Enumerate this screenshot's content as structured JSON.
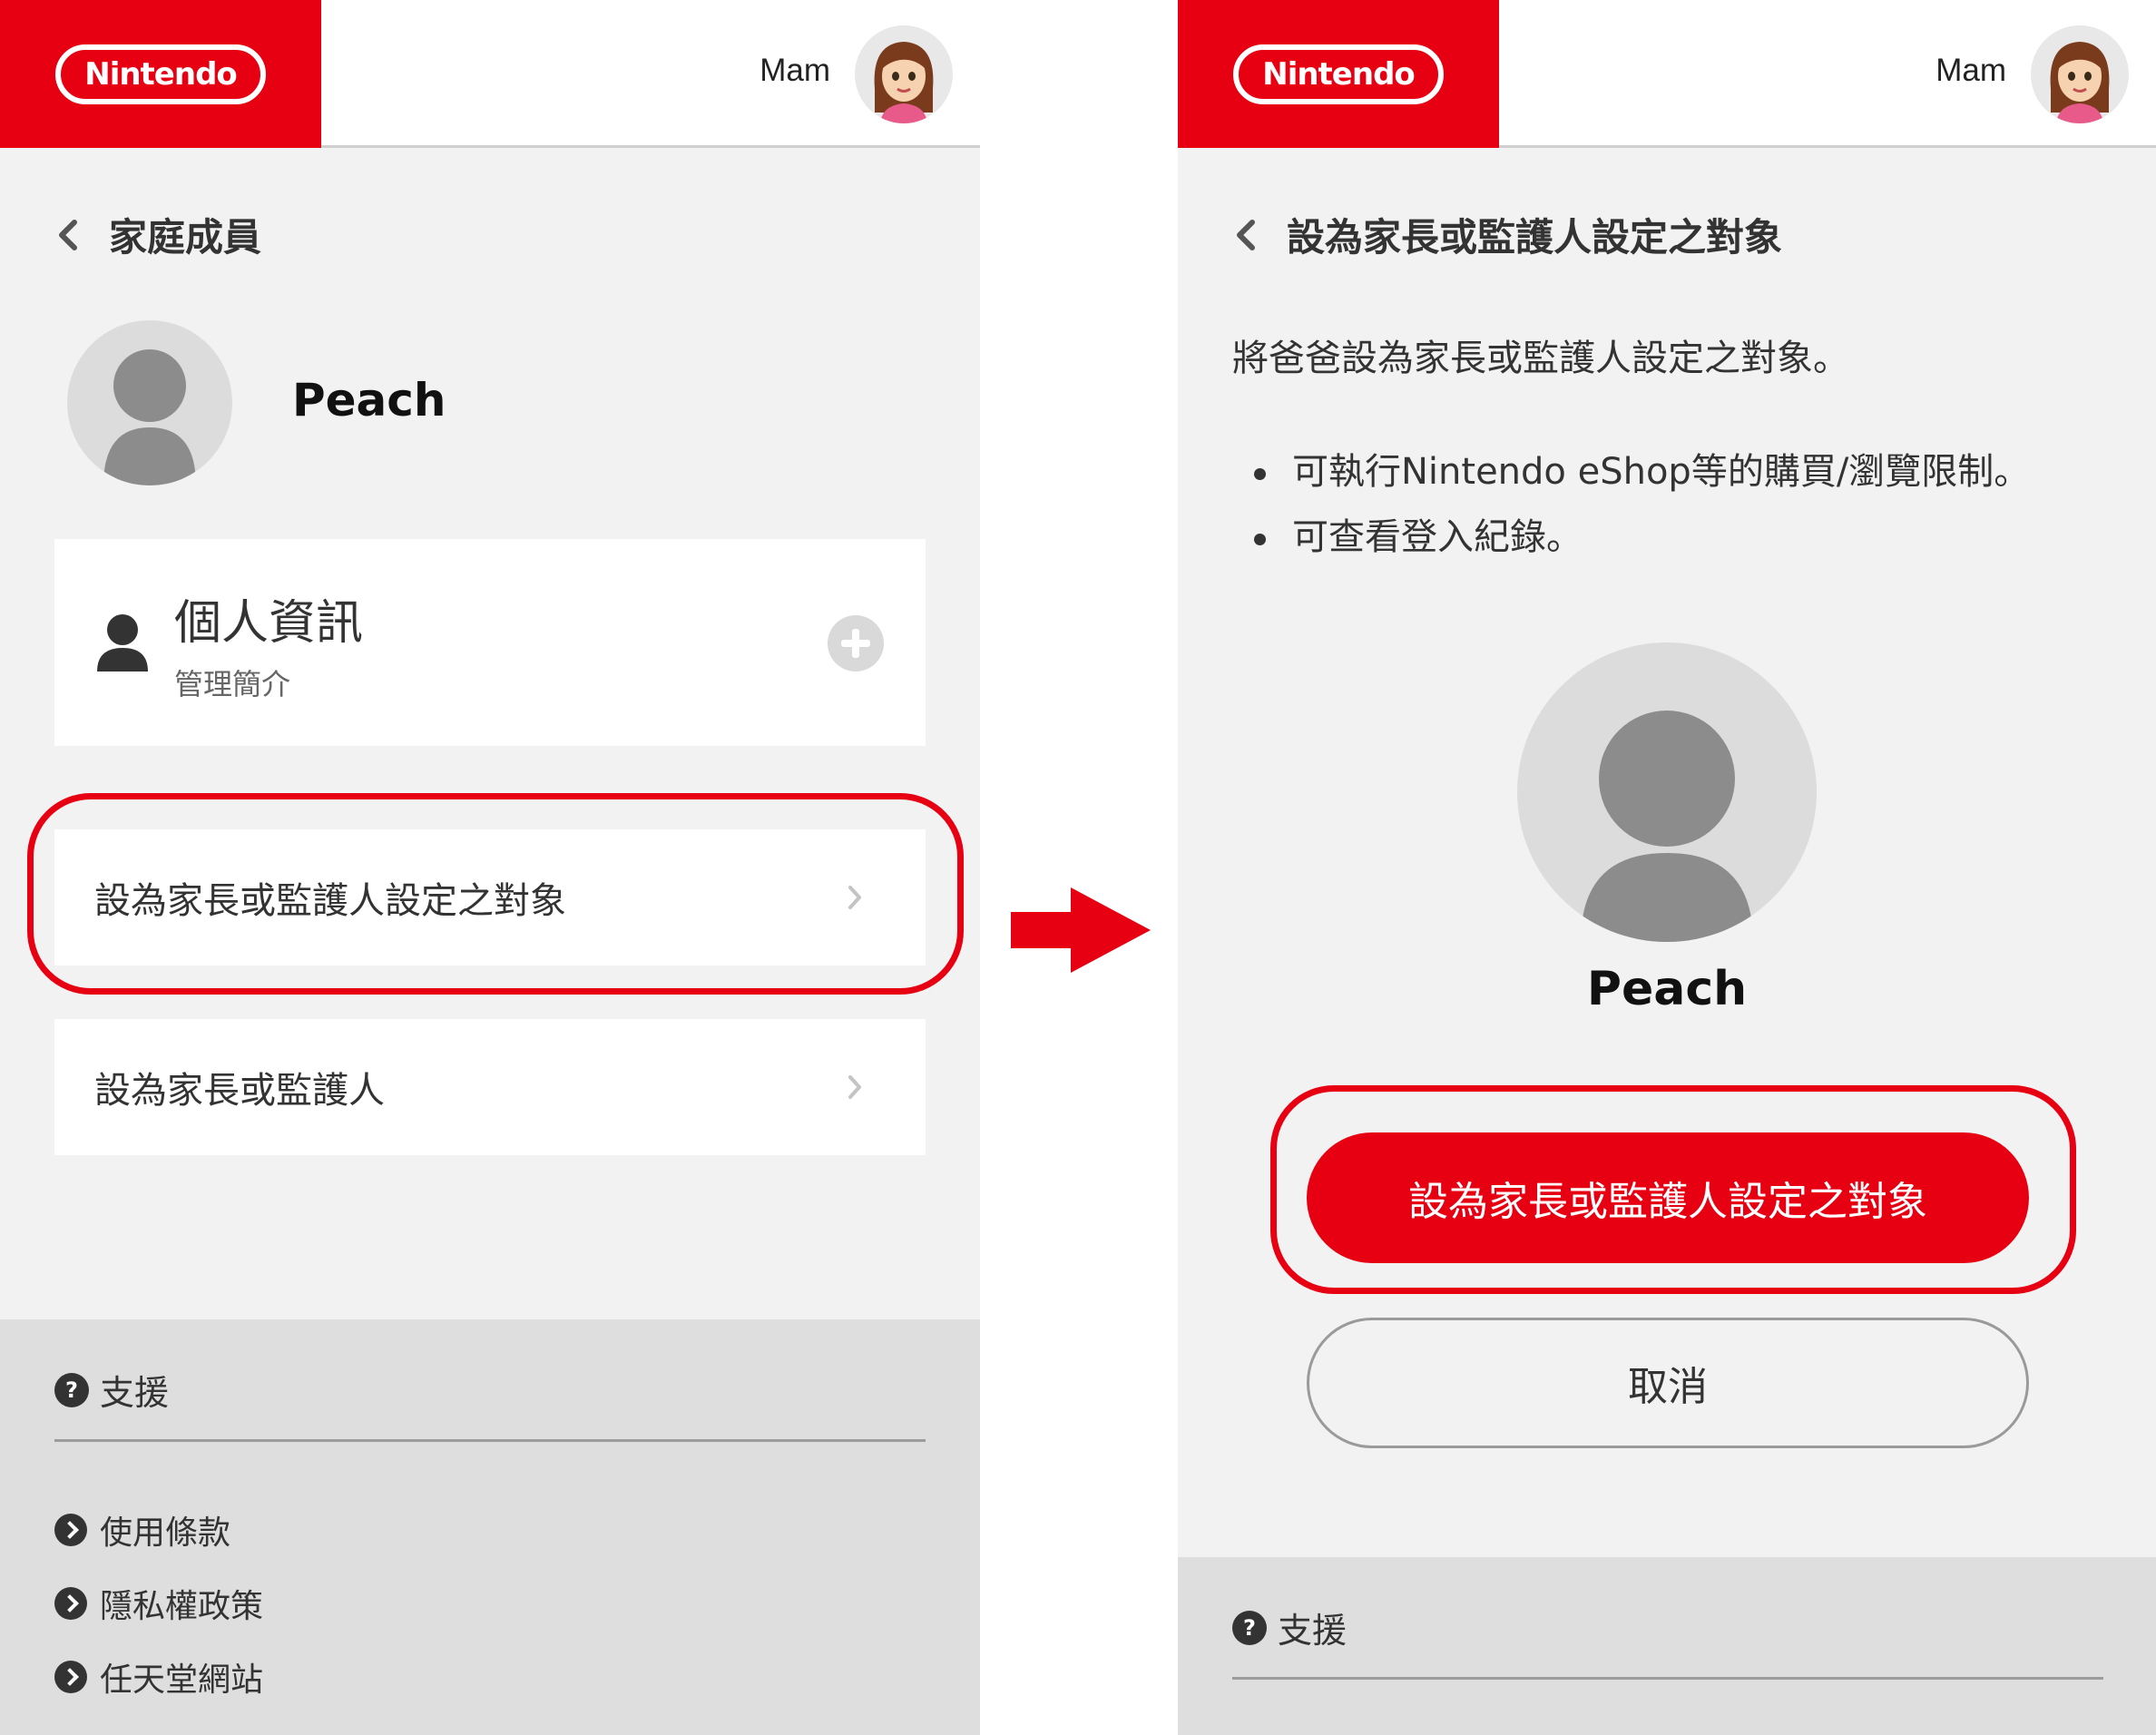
{
  "colors": {
    "brand_red": "#e60012",
    "page_bg": "#f2f2f2",
    "footer_bg": "#dedede",
    "text": "#333333"
  },
  "left_screen": {
    "header": {
      "logo_text": "Nintendo",
      "user_name": "Mam",
      "user_avatar_icon": "mii-avatar-icon"
    },
    "back_title": "家庭成員",
    "profile_name": "Peach",
    "info_card": {
      "title": "個人資訊",
      "subtitle": "管理簡介",
      "icon": "person-icon",
      "action_icon": "plus-circle-icon"
    },
    "menu": [
      {
        "label": "設為家長或監護人設定之對象",
        "icon": "chevron-right-icon"
      },
      {
        "label": "設為家長或監護人",
        "icon": "chevron-right-icon"
      }
    ],
    "footer": {
      "support_label": "支援",
      "links": [
        "使用條款",
        "隱私權政策",
        "任天堂網站"
      ]
    }
  },
  "right_screen": {
    "header": {
      "logo_text": "Nintendo",
      "user_name": "Mam",
      "user_avatar_icon": "mii-avatar-icon"
    },
    "back_title": "設為家長或監護人設定之對象",
    "description": "將爸爸設為家長或監護人設定之對象。",
    "bullets": [
      "可執行Nintendo eShop等的購買/瀏覽限制。",
      "可查看登入紀錄。"
    ],
    "profile_name": "Peach",
    "primary_button": "設為家長或監護人設定之對象",
    "cancel_button": "取消",
    "footer": {
      "support_label": "支援"
    }
  }
}
